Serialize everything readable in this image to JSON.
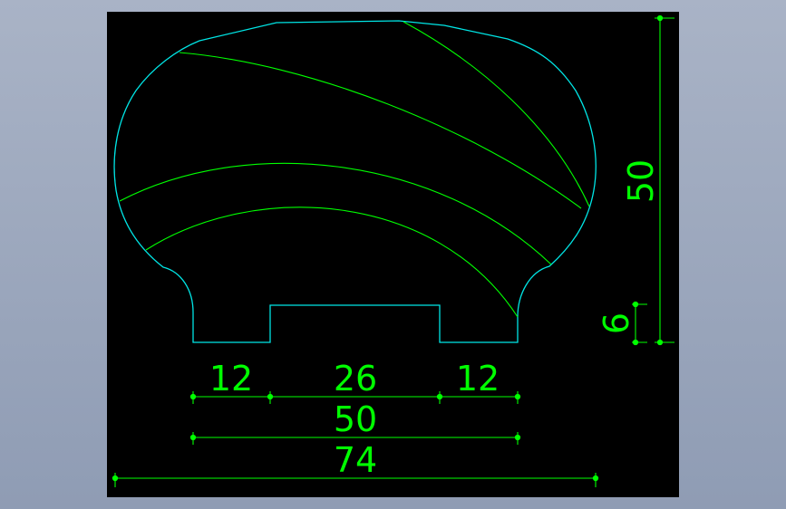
{
  "colors": {
    "background_chrome": "#9aa5bb",
    "viewport": "#000000",
    "profile_outline": "#00e5e5",
    "hatch_lines": "#00ff00",
    "dimensions": "#00ff00"
  },
  "dimensions": {
    "left_foot": "12",
    "groove": "26",
    "right_foot": "12",
    "base_width": "50",
    "overall_width": "74",
    "overall_height": "50",
    "groove_depth": "6"
  }
}
